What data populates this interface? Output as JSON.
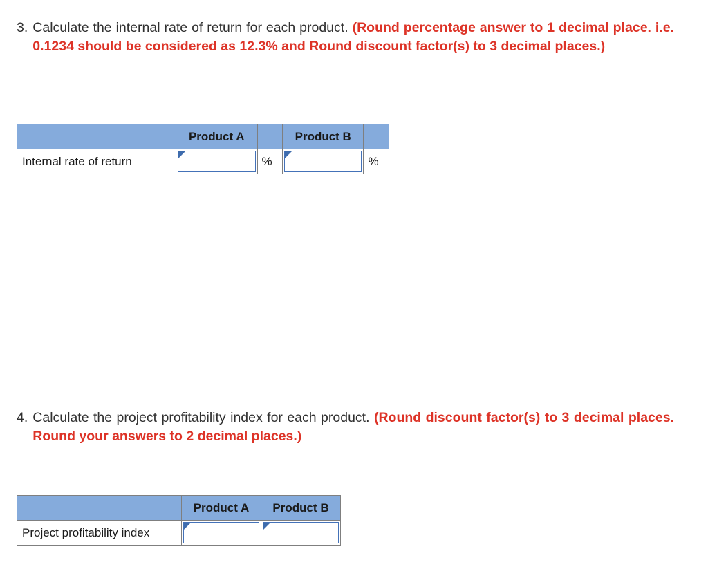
{
  "questions": [
    {
      "number": "3.",
      "prompt": "Calculate the internal rate of return for each product. ",
      "note": "(Round percentage answer to 1 decimal place. i.e. 0.1234 should be considered as 12.3% and Round discount factor(s) to 3 decimal places.)"
    },
    {
      "number": "4.",
      "prompt": "Calculate the project profitability index for each product. ",
      "note": "(Round discount factor(s) to 3 decimal places. Round your answers to 2 decimal places.)"
    }
  ],
  "tables": {
    "irr": {
      "headers": [
        "",
        "Product A",
        "",
        "Product B",
        ""
      ],
      "row_label": "Internal rate of return",
      "product_a_value": "",
      "product_a_unit": "%",
      "product_b_value": "",
      "product_b_unit": "%"
    },
    "ppi": {
      "headers": [
        "",
        "Product A",
        "Product B"
      ],
      "row_label": "Project profitability index",
      "product_a_value": "",
      "product_b_value": ""
    }
  },
  "colors": {
    "header_blue": "#85abdc",
    "note_red": "#dd3327",
    "input_border_blue": "#4472b8",
    "marker_blue": "#3e6cad",
    "grid_gray": "#7f7f7f",
    "text_dark": "#303030"
  }
}
